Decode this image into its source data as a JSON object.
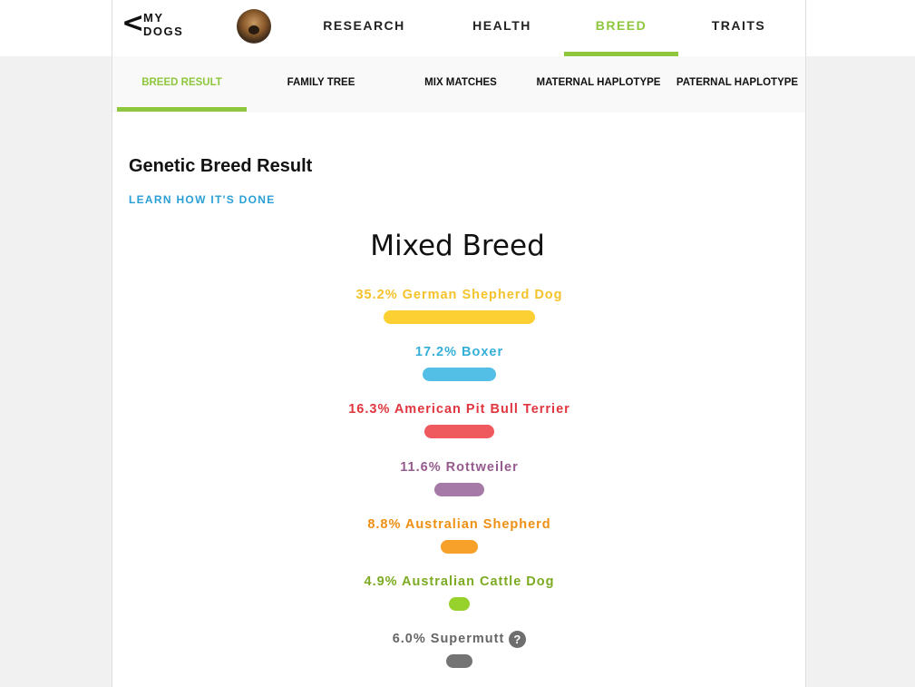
{
  "back": {
    "label_line1": "MY",
    "label_line2": "DOGS"
  },
  "nav": [
    {
      "label": "RESEARCH",
      "active": false
    },
    {
      "label": "HEALTH",
      "active": false
    },
    {
      "label": "BREED",
      "active": true
    },
    {
      "label": "TRAITS",
      "active": false
    }
  ],
  "subtabs": [
    {
      "label": "BREED RESULT",
      "active": true
    },
    {
      "label": "FAMILY TREE",
      "active": false
    },
    {
      "label": "MIX MATCHES",
      "active": false
    },
    {
      "label": "MATERNAL HAPLOTYPE",
      "active": false
    },
    {
      "label": "PATERNAL HAPLOTYPE",
      "active": false
    }
  ],
  "section": {
    "title": "Genetic Breed Result",
    "learn_link": "LEARN HOW IT'S DONE",
    "result_heading": "Mixed Breed"
  },
  "breeds": [
    {
      "label": "35.2% German Shepherd Dog",
      "percent": 35.2,
      "color": "#f4c22b",
      "bar_color": "#fccf32"
    },
    {
      "label": "17.2% Boxer",
      "percent": 17.2,
      "color": "#34afd8",
      "bar_color": "#53bfe6"
    },
    {
      "label": "16.3% American Pit Bull Terrier",
      "percent": 16.3,
      "color": "#e0363f",
      "bar_color": "#ef5a5f"
    },
    {
      "label": "11.6% Rottweiler",
      "percent": 11.6,
      "color": "#955b8e",
      "bar_color": "#a57aa6"
    },
    {
      "label": "8.8% Australian Shepherd",
      "percent": 8.8,
      "color": "#ee8f12",
      "bar_color": "#f7a02a"
    },
    {
      "label": "4.9% Australian Cattle Dog",
      "percent": 4.9,
      "color": "#7cab23",
      "bar_color": "#97d12b"
    },
    {
      "label": "6.0% Supermutt",
      "percent": 6.0,
      "color": "#666666",
      "bar_color": "#747474",
      "help_icon": "?"
    }
  ],
  "colors": {
    "accent": "#8ec73d",
    "link": "#2a9fd6"
  },
  "icons": {
    "back": "chevron-left-icon",
    "help": "question-circle-icon",
    "avatar": "dog-avatar"
  }
}
